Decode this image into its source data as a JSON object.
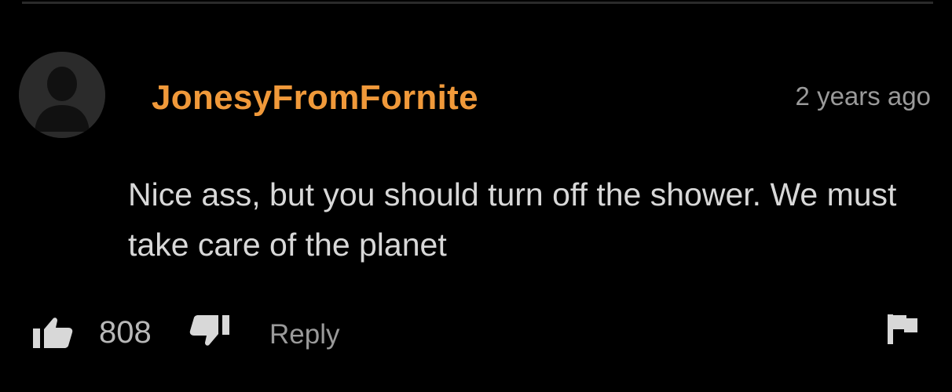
{
  "comment": {
    "username": "JonesyFromFornite",
    "timestamp": "2 years ago",
    "text": "Nice ass, but you should turn off the shower. We must take care of the planet",
    "avatar_icon": "default-user-silhouette"
  },
  "actions": {
    "like_icon": "thumbs-up-icon",
    "like_count": "808",
    "dislike_icon": "thumbs-down-icon",
    "reply_label": "Reply",
    "flag_icon": "flag-icon"
  },
  "colors": {
    "background": "#000000",
    "username": "#f0993a",
    "text": "#d8d8d8",
    "muted": "#9a9a9a"
  }
}
